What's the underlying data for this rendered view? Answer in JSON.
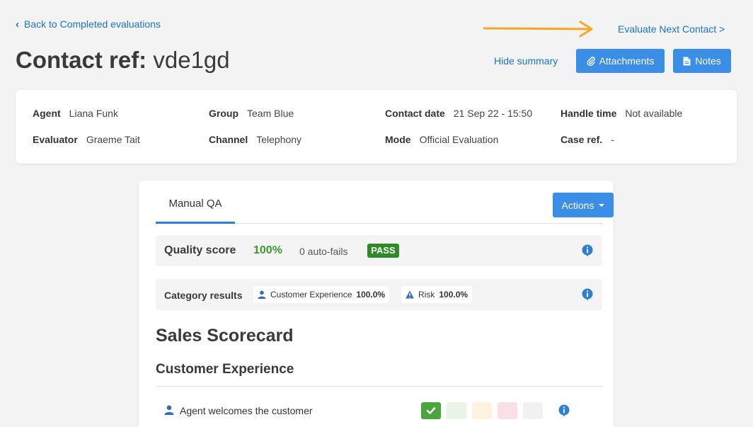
{
  "nav": {
    "back_label": "Back to Completed evaluations",
    "next_label": "Evaluate Next Contact >"
  },
  "header": {
    "title_label": "Contact ref:",
    "title_value": "vde1gd",
    "hide_summary": "Hide summary",
    "attachments": "Attachments",
    "notes": "Notes"
  },
  "summary": {
    "agent": {
      "label": "Agent",
      "value": "Liana Funk"
    },
    "evaluator": {
      "label": "Evaluator",
      "value": "Graeme Tait"
    },
    "group": {
      "label": "Group",
      "value": "Team Blue"
    },
    "channel": {
      "label": "Channel",
      "value": "Telephony"
    },
    "contact_date": {
      "label": "Contact date",
      "value": "21 Sep 22 - 15:50"
    },
    "mode": {
      "label": "Mode",
      "value": "Official Evaluation"
    },
    "handle_time": {
      "label": "Handle time",
      "value": "Not available"
    },
    "case_ref": {
      "label": "Case ref.",
      "value": "-"
    }
  },
  "evaluation": {
    "tab": "Manual QA",
    "actions": "Actions",
    "quality": {
      "label": "Quality score",
      "score": "100%",
      "auto_fails": "0 auto-fails",
      "result": "PASS"
    },
    "categories": {
      "label": "Category results",
      "items": [
        {
          "icon": "person-icon",
          "name": "Customer Experience",
          "value": "100.0%"
        },
        {
          "icon": "warning-icon",
          "name": "Risk",
          "value": "100.0%"
        }
      ]
    },
    "scorecard_title": "Sales Scorecard",
    "section_title": "Customer Experience",
    "questions": [
      {
        "text": "Agent welcomes the customer",
        "selected": "check"
      }
    ]
  },
  "colors": {
    "accent": "#3a8ee6",
    "link": "#1a73c8",
    "pass": "#2e8b25",
    "score": "#3a9a2a",
    "annotation_arrow": "#f5a623"
  }
}
